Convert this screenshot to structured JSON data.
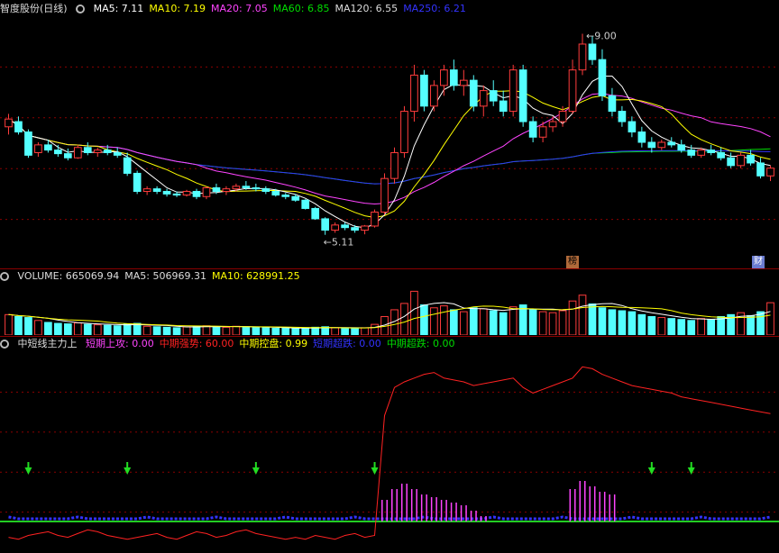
{
  "header1": {
    "title": "智度股份(日线)",
    "items": [
      {
        "label": "MA5:",
        "value": "7.11",
        "color": "#ffffff"
      },
      {
        "label": "MA10:",
        "value": "7.19",
        "color": "#ffff00"
      },
      {
        "label": "MA20:",
        "value": "7.05",
        "color": "#ff44ff"
      },
      {
        "label": "MA60:",
        "value": "6.85",
        "color": "#00dd00"
      },
      {
        "label": "MA120:",
        "value": "6.55",
        "color": "#dddddd"
      },
      {
        "label": "MA250:",
        "value": "6.21",
        "color": "#3333ff"
      }
    ]
  },
  "header2": {
    "items": [
      {
        "label": "VOLUME:",
        "value": "665069.94",
        "color": "#dddddd"
      },
      {
        "label": "MA5:",
        "value": "506969.31",
        "color": "#dddddd"
      },
      {
        "label": "MA10:",
        "value": "628991.25",
        "color": "#ffff00"
      }
    ]
  },
  "header3": {
    "title": "中短线主力上",
    "items": [
      {
        "label": "短期上攻:",
        "value": "0.00",
        "color": "#ff44ff"
      },
      {
        "label": "中期强势:",
        "value": "60.00",
        "color": "#ff2222"
      },
      {
        "label": "中期控盘:",
        "value": "0.99",
        "color": "#ffff00"
      },
      {
        "label": "短期超跌:",
        "value": "0.00",
        "color": "#3333ff"
      },
      {
        "label": "中期超跌:",
        "value": "0.00",
        "color": "#00dd00"
      }
    ]
  },
  "annotations": {
    "high": "9.00",
    "low": "5.11",
    "tag_bang": "榜",
    "tag_cai": "财"
  },
  "colors": {
    "up": "#ff3c3c",
    "down": "#54ffff",
    "ma5": "#ffffff",
    "ma10": "#ffff00",
    "ma20": "#ff44ff",
    "ma60": "#00dd00",
    "ma250": "#3333ff",
    "grid": "#8a0000"
  },
  "chart_data": {
    "type": "candlestick",
    "price_range": [
      4.6,
      9.2
    ],
    "candles": [
      [
        7.2,
        7.45,
        7.05,
        7.35
      ],
      [
        7.3,
        7.4,
        7.05,
        7.1
      ],
      [
        7.1,
        7.15,
        6.6,
        6.65
      ],
      [
        6.7,
        6.9,
        6.62,
        6.85
      ],
      [
        6.85,
        6.95,
        6.7,
        6.75
      ],
      [
        6.75,
        6.85,
        6.62,
        6.68
      ],
      [
        6.68,
        6.78,
        6.55,
        6.6
      ],
      [
        6.6,
        6.85,
        6.58,
        6.8
      ],
      [
        6.8,
        6.9,
        6.65,
        6.7
      ],
      [
        6.7,
        6.8,
        6.62,
        6.75
      ],
      [
        6.75,
        6.85,
        6.65,
        6.7
      ],
      [
        6.7,
        6.8,
        6.6,
        6.65
      ],
      [
        6.6,
        6.7,
        6.25,
        6.3
      ],
      [
        6.3,
        6.35,
        5.9,
        5.95
      ],
      [
        5.95,
        6.05,
        5.88,
        6.0
      ],
      [
        6.0,
        6.05,
        5.9,
        5.95
      ],
      [
        5.95,
        6.0,
        5.85,
        5.9
      ],
      [
        5.9,
        5.95,
        5.84,
        5.88
      ],
      [
        5.88,
        5.98,
        5.85,
        5.95
      ],
      [
        5.95,
        6.0,
        5.8,
        5.85
      ],
      [
        5.85,
        6.05,
        5.8,
        6.02
      ],
      [
        6.02,
        6.1,
        5.9,
        5.95
      ],
      [
        5.95,
        6.05,
        5.88,
        6.0
      ],
      [
        6.0,
        6.1,
        5.95,
        6.05
      ],
      [
        6.05,
        6.15,
        5.98,
        6.02
      ],
      [
        6.02,
        6.1,
        5.95,
        6.0
      ],
      [
        6.0,
        6.05,
        5.9,
        5.95
      ],
      [
        5.95,
        6.0,
        5.85,
        5.88
      ],
      [
        5.88,
        5.92,
        5.8,
        5.85
      ],
      [
        5.85,
        5.9,
        5.75,
        5.78
      ],
      [
        5.78,
        5.8,
        5.6,
        5.62
      ],
      [
        5.62,
        5.65,
        5.4,
        5.42
      ],
      [
        5.42,
        5.45,
        5.11,
        5.2
      ],
      [
        5.2,
        5.35,
        5.15,
        5.3
      ],
      [
        5.3,
        5.35,
        5.2,
        5.25
      ],
      [
        5.25,
        5.3,
        5.15,
        5.2
      ],
      [
        5.2,
        5.3,
        5.12,
        5.28
      ],
      [
        5.28,
        5.6,
        5.25,
        5.55
      ],
      [
        5.55,
        6.3,
        5.5,
        6.2
      ],
      [
        6.2,
        6.8,
        6.1,
        6.7
      ],
      [
        6.7,
        7.6,
        6.6,
        7.5
      ],
      [
        7.5,
        8.4,
        7.3,
        8.2
      ],
      [
        8.2,
        8.3,
        7.5,
        7.6
      ],
      [
        7.6,
        8.1,
        7.5,
        8.0
      ],
      [
        8.0,
        8.4,
        7.8,
        8.3
      ],
      [
        8.3,
        8.5,
        7.9,
        8.0
      ],
      [
        8.0,
        8.3,
        7.8,
        8.1
      ],
      [
        8.1,
        8.2,
        7.5,
        7.6
      ],
      [
        7.6,
        8.0,
        7.4,
        7.9
      ],
      [
        7.9,
        8.1,
        7.6,
        7.7
      ],
      [
        7.7,
        7.9,
        7.4,
        7.5
      ],
      [
        7.5,
        8.4,
        7.4,
        8.3
      ],
      [
        8.3,
        8.4,
        7.2,
        7.3
      ],
      [
        7.3,
        7.4,
        6.9,
        7.0
      ],
      [
        7.0,
        7.3,
        6.9,
        7.2
      ],
      [
        7.2,
        7.4,
        7.1,
        7.3
      ],
      [
        7.3,
        7.6,
        7.2,
        7.5
      ],
      [
        7.5,
        8.5,
        7.45,
        8.3
      ],
      [
        8.3,
        9.0,
        8.2,
        8.8
      ],
      [
        8.8,
        8.95,
        8.4,
        8.5
      ],
      [
        8.5,
        8.7,
        7.7,
        7.8
      ],
      [
        7.8,
        7.95,
        7.4,
        7.5
      ],
      [
        7.5,
        7.6,
        7.2,
        7.3
      ],
      [
        7.3,
        7.4,
        7.0,
        7.1
      ],
      [
        7.1,
        7.2,
        6.8,
        6.9
      ],
      [
        6.9,
        7.0,
        6.7,
        6.8
      ],
      [
        6.8,
        6.95,
        6.75,
        6.9
      ],
      [
        6.9,
        7.0,
        6.8,
        6.85
      ],
      [
        6.85,
        6.95,
        6.7,
        6.75
      ],
      [
        6.75,
        6.85,
        6.6,
        6.65
      ],
      [
        6.65,
        6.8,
        6.6,
        6.75
      ],
      [
        6.75,
        6.85,
        6.65,
        6.7
      ],
      [
        6.7,
        6.8,
        6.55,
        6.6
      ],
      [
        6.6,
        6.7,
        6.4,
        6.45
      ],
      [
        6.45,
        6.7,
        6.4,
        6.65
      ],
      [
        6.65,
        6.75,
        6.45,
        6.5
      ],
      [
        6.5,
        6.6,
        6.2,
        6.25
      ],
      [
        6.25,
        6.45,
        6.15,
        6.4
      ]
    ],
    "volume_range": [
      0,
      1000000
    ],
    "volume": [
      420000,
      380000,
      360000,
      300000,
      260000,
      240000,
      230000,
      250000,
      220000,
      210000,
      200000,
      190000,
      230000,
      240000,
      180000,
      170000,
      160000,
      150000,
      170000,
      180000,
      190000,
      170000,
      160000,
      180000,
      170000,
      160000,
      150000,
      140000,
      140000,
      130000,
      150000,
      160000,
      170000,
      150000,
      140000,
      130000,
      150000,
      220000,
      380000,
      520000,
      650000,
      900000,
      620000,
      560000,
      600000,
      520000,
      480000,
      560000,
      540000,
      500000,
      460000,
      580000,
      620000,
      520000,
      480000,
      460000,
      500000,
      700000,
      820000,
      640000,
      560000,
      520000,
      500000,
      480000,
      420000,
      380000,
      360000,
      340000,
      320000,
      300000,
      340000,
      320000,
      380000,
      420000,
      460000,
      400000,
      480000,
      665069
    ]
  },
  "indicator": {
    "strong_line_range": [
      0,
      100
    ],
    "strong_line": [
      5,
      4,
      6,
      7,
      8,
      6,
      5,
      7,
      9,
      8,
      6,
      5,
      4,
      5,
      6,
      7,
      5,
      4,
      6,
      8,
      7,
      5,
      6,
      8,
      9,
      7,
      6,
      5,
      4,
      5,
      4,
      6,
      5,
      4,
      6,
      7,
      5,
      6,
      70,
      85,
      88,
      90,
      92,
      93,
      90,
      89,
      88,
      86,
      87,
      88,
      89,
      90,
      85,
      82,
      84,
      86,
      88,
      90,
      96,
      95,
      92,
      90,
      88,
      86,
      85,
      84,
      83,
      82,
      80,
      79,
      78,
      77,
      76,
      75,
      74,
      73,
      72,
      71
    ],
    "short_attack": [
      0,
      0,
      0,
      0,
      0,
      0,
      0,
      0,
      0,
      0,
      0,
      0,
      0,
      0,
      0,
      0,
      0,
      0,
      0,
      0,
      0,
      0,
      0,
      0,
      0,
      0,
      0,
      0,
      0,
      0,
      0,
      0,
      0,
      0,
      0,
      0,
      0,
      0,
      8,
      12,
      14,
      12,
      10,
      9,
      8,
      7,
      6,
      4,
      2,
      0,
      0,
      0,
      0,
      0,
      0,
      0,
      0,
      12,
      15,
      13,
      11,
      10,
      0,
      0,
      0,
      0,
      0,
      0,
      0,
      0,
      0,
      0,
      0,
      0,
      0,
      0,
      0,
      0
    ],
    "arrows": [
      2,
      12,
      25,
      37,
      65,
      69,
      81
    ]
  }
}
